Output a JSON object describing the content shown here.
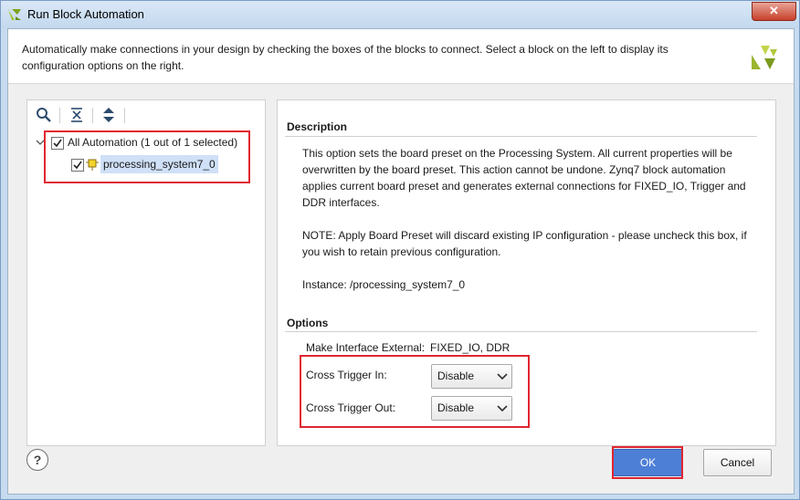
{
  "window": {
    "title": "Run Block Automation",
    "close_glyph": "✕"
  },
  "header": {
    "description": "Automatically make connections in your design by checking the boxes of the blocks to connect. Select a block on the left to display its configuration options on the right."
  },
  "tree": {
    "items": [
      {
        "label": "All Automation (1 out of 1 selected)",
        "checked": true,
        "expanded": true
      },
      {
        "label": "processing_system7_0",
        "checked": true,
        "selected": true
      }
    ]
  },
  "description": {
    "title": "Description",
    "paragraph1": "This option sets the board preset on the Processing System. All current properties will be overwritten by the board preset. This action cannot be undone. Zynq7 block automation applies current board preset and generates external connections for FIXED_IO, Trigger and DDR interfaces.",
    "paragraph2": "NOTE: Apply Board Preset will discard existing IP configuration - please uncheck this box, if you wish to retain previous configuration.",
    "instance": "Instance: /processing_system7_0"
  },
  "options": {
    "title": "Options",
    "make_interface_label": "Make Interface External:",
    "make_interface_value": "FIXED_IO, DDR",
    "cross_trigger_in_label": "Cross Trigger In:",
    "cross_trigger_in_value": "Disable",
    "cross_trigger_out_label": "Cross Trigger Out:",
    "cross_trigger_out_value": "Disable"
  },
  "buttons": {
    "help": "?",
    "ok": "OK",
    "cancel": "Cancel"
  },
  "colors": {
    "highlight_red": "#e0262f",
    "ok_blue": "#4d7fd7",
    "selection_blue": "#cfe0f7"
  }
}
